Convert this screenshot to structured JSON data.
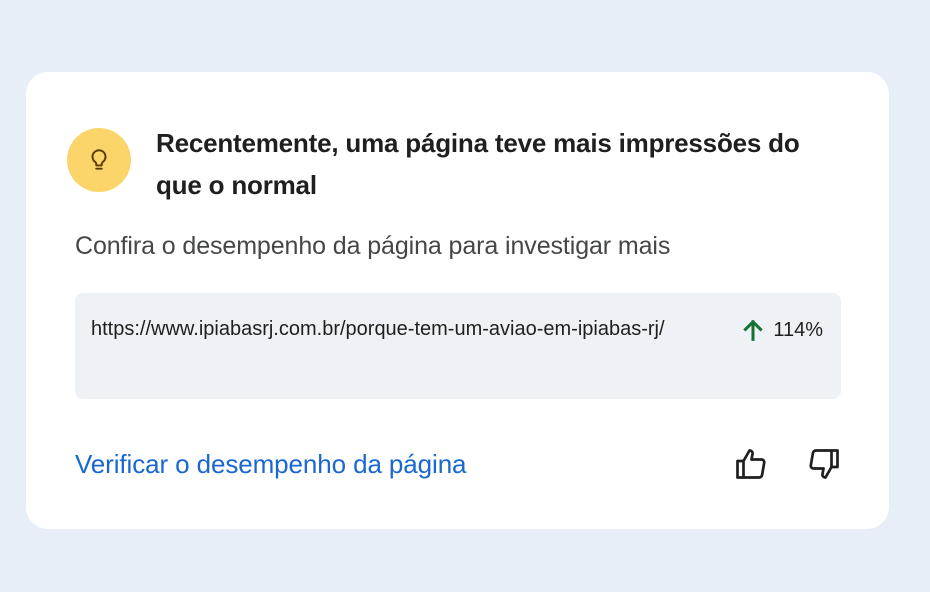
{
  "card": {
    "icon": "lightbulb-icon",
    "title": "Recentemente, uma página teve mais impressões do que o normal",
    "subtitle": "Confira o desempenho da página para investigar mais",
    "page": {
      "url": "https://www.ipiabasrj.com.br/porque-tem-um-aviao-em-ipiabas-rj/",
      "change_icon": "arrow-up-icon",
      "change": "114%"
    },
    "action_label": "Verificar o desempenho da página",
    "feedback": {
      "like_icon": "thumb-up-icon",
      "dislike_icon": "thumb-down-icon"
    }
  },
  "colors": {
    "background": "#e8eef7",
    "card": "#ffffff",
    "icon_badge": "#fcd56a",
    "link": "#1a67d2",
    "positive": "#137333"
  }
}
